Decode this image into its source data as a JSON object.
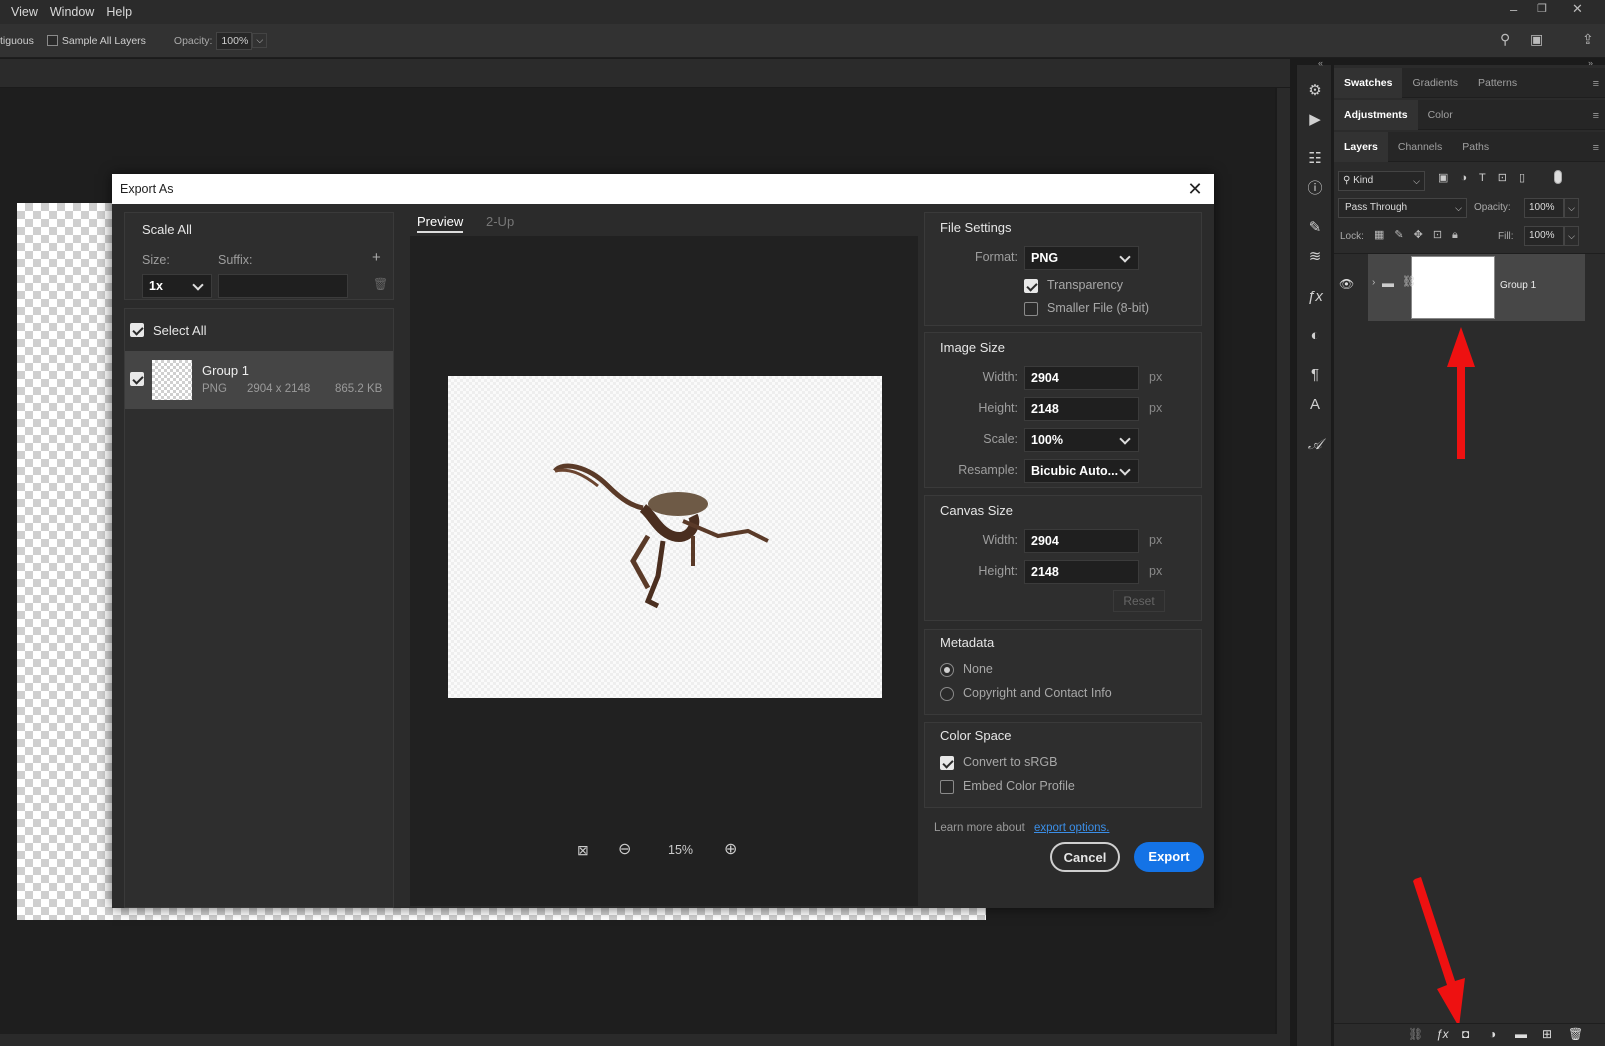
{
  "menubar": {
    "items": [
      "View",
      "Window",
      "Help"
    ]
  },
  "optionsbar": {
    "contiguous_label": "tiguous",
    "sample_all_layers": "Sample All Layers",
    "opacity_label": "Opacity:",
    "opacity_value": "100%"
  },
  "right_panel": {
    "tabs_row1": [
      "Swatches",
      "Gradients",
      "Patterns"
    ],
    "tabs_row2": [
      "Adjustments",
      "Color"
    ],
    "tabs_row3": [
      "Layers",
      "Channels",
      "Paths"
    ],
    "kind_label": "Kind",
    "blend_mode": "Pass Through",
    "opacity_label": "Opacity:",
    "opacity_value": "100%",
    "lock_label": "Lock:",
    "fill_label": "Fill:",
    "fill_value": "100%",
    "layer_name": "Group 1"
  },
  "dialog": {
    "title": "Export As",
    "scale_all": "Scale All",
    "size_label": "Size:",
    "suffix_label": "Suffix:",
    "size_value": "1x",
    "select_all": "Select All",
    "asset": {
      "name": "Group 1",
      "format": "PNG",
      "dims": "2904 x 2148",
      "filesize": "865.2 KB"
    },
    "preview_tabs": [
      "Preview",
      "2-Up"
    ],
    "zoom": "15%",
    "file_settings": {
      "heading": "File Settings",
      "format_label": "Format:",
      "format_value": "PNG",
      "transparency": "Transparency",
      "smaller_file": "Smaller File (8-bit)"
    },
    "image_size": {
      "heading": "Image Size",
      "width_label": "Width:",
      "width": "2904",
      "height_label": "Height:",
      "height": "2148",
      "scale_label": "Scale:",
      "scale": "100%",
      "resample_label": "Resample:",
      "resample": "Bicubic Auto...",
      "unit": "px"
    },
    "canvas_size": {
      "heading": "Canvas Size",
      "width_label": "Width:",
      "width": "2904",
      "height_label": "Height:",
      "height": "2148",
      "reset": "Reset",
      "unit": "px"
    },
    "metadata": {
      "heading": "Metadata",
      "none": "None",
      "copyright": "Copyright and Contact Info"
    },
    "color_space": {
      "heading": "Color Space",
      "convert": "Convert to sRGB",
      "embed": "Embed Color Profile"
    },
    "learn_more": "Learn more about",
    "export_options_link": "export options.",
    "cancel": "Cancel",
    "export": "Export"
  },
  "colors": {
    "accent": "#1473e6",
    "annotation_arrow": "#ee1111"
  }
}
